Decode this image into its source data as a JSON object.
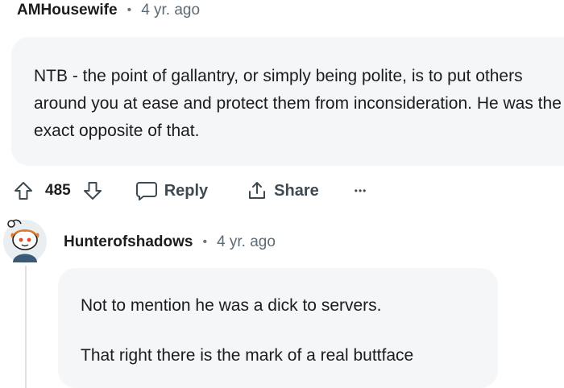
{
  "comment1": {
    "author": "AMHousewife",
    "separator": "•",
    "time": "4 yr. ago",
    "body": "NTB - the point of gallantry, or simply being polite, is to put others around you at ease and protect them from inconsideration. He was the exact opposite of that.",
    "votes": "485",
    "reply_label": "Reply",
    "share_label": "Share",
    "more_label": "•••"
  },
  "comment2": {
    "author": "Hunterofshadows",
    "separator": "•",
    "time": "4 yr. ago",
    "paragraphs": [
      "Not to mention he was a dick to servers.",
      "That right there is the mark of a real buttface"
    ]
  },
  "icons": {
    "upvote": "arrow-up-icon",
    "downvote": "arrow-down-icon",
    "reply": "speech-bubble-icon",
    "share": "share-icon",
    "more": "ellipsis-icon",
    "avatar": "snoo-avatar"
  },
  "colors": {
    "bubble_bg": "#f4f6f7",
    "muted_text": "#5c6a73",
    "icon_stroke": "#3e4a52"
  }
}
